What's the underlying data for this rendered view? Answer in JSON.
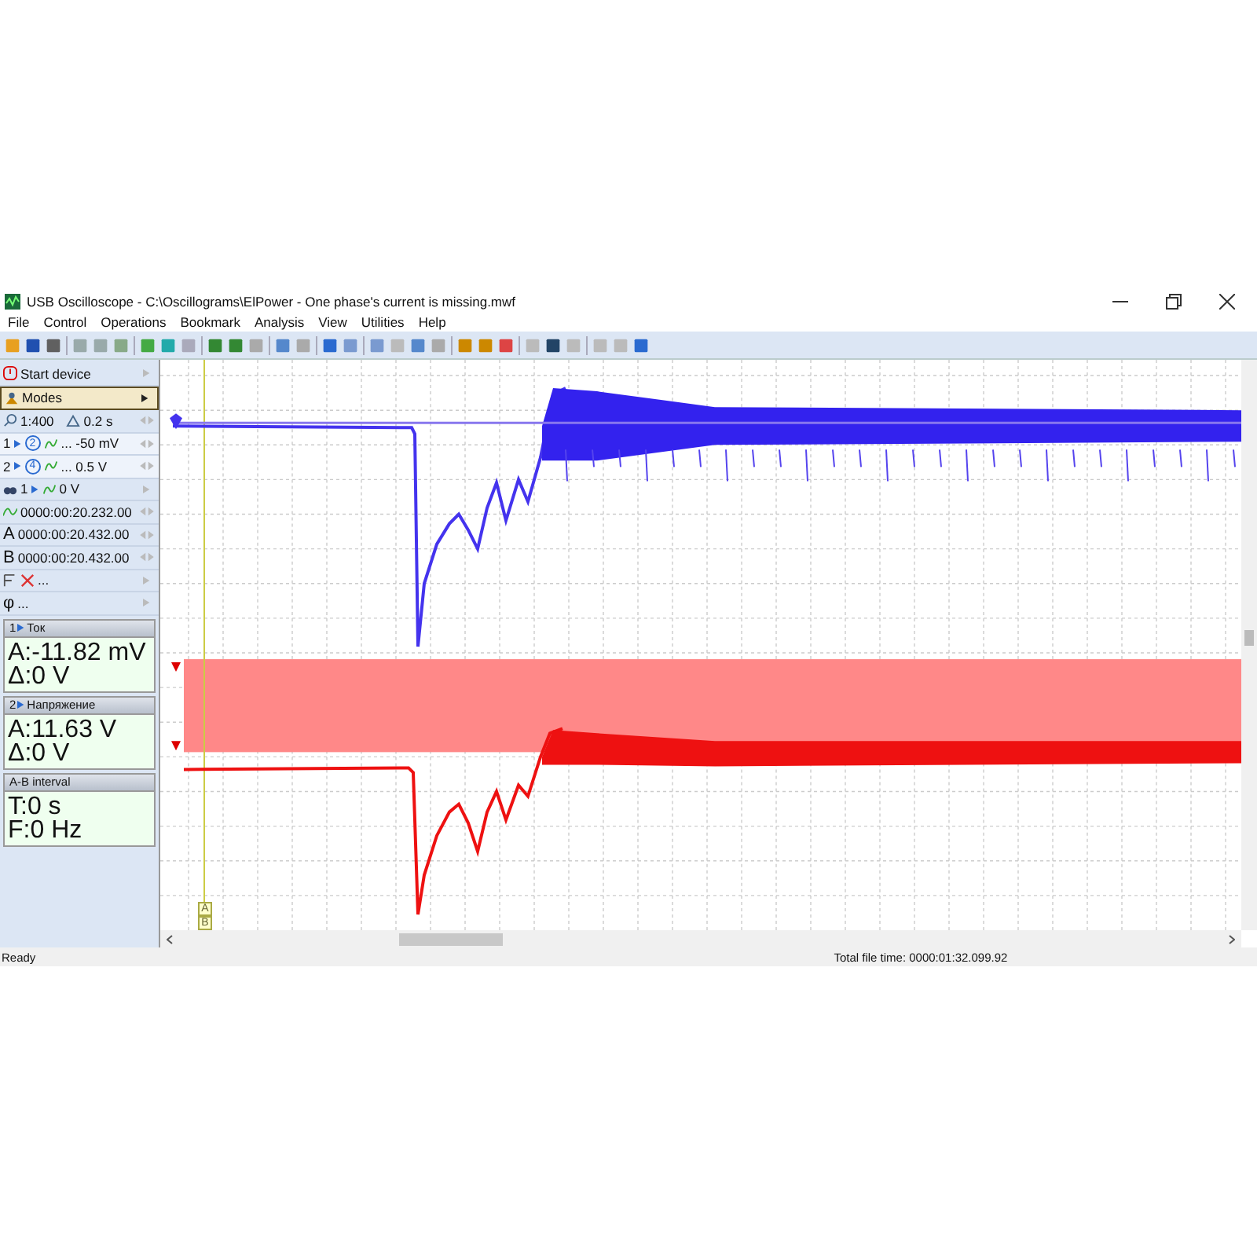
{
  "window": {
    "title": "USB Oscilloscope - C:\\Oscillograms\\ElPower - One phase's current is missing.mwf"
  },
  "menu": [
    "File",
    "Control",
    "Operations",
    "Bookmark",
    "Analysis",
    "View",
    "Utilities",
    "Help"
  ],
  "sidebar": {
    "rows": [
      {
        "kind": "power",
        "text": "Start device"
      },
      {
        "kind": "modes",
        "text": "Modes"
      },
      {
        "kind": "scale",
        "text": "1:400",
        "time": "0.2 s"
      },
      {
        "kind": "channel",
        "number": "1",
        "range": "2",
        "text": "... -50 mV"
      },
      {
        "kind": "channel",
        "number": "2",
        "range": "4",
        "text": "... 0.5 V"
      },
      {
        "kind": "trigger",
        "number": "1",
        "text": "0 V"
      },
      {
        "kind": "position",
        "text": "0000:00:20.232.00"
      },
      {
        "kind": "cursor",
        "letter": "A",
        "text": "0000:00:20.432.00"
      },
      {
        "kind": "cursor",
        "letter": "B",
        "text": "0000:00:20.432.00"
      },
      {
        "kind": "filter",
        "text": "..."
      },
      {
        "kind": "phase",
        "letter": "φ",
        "text": "..."
      }
    ],
    "panels": [
      {
        "number": "1",
        "header": "Ток",
        "lines": [
          "A:-11.82 mV",
          "Δ:0 V"
        ]
      },
      {
        "number": "2",
        "header": "Напряжение",
        "lines": [
          "A:11.63 V",
          "Δ:0 V"
        ]
      },
      {
        "header": "A-B interval",
        "lines": [
          "T:0 s",
          "F:0 Hz"
        ]
      }
    ]
  },
  "plot": {
    "cursors": [
      "A",
      "B"
    ]
  },
  "status_bar": {
    "left": "Ready",
    "right": "Total file time: 0000:01:32.099.92"
  }
}
